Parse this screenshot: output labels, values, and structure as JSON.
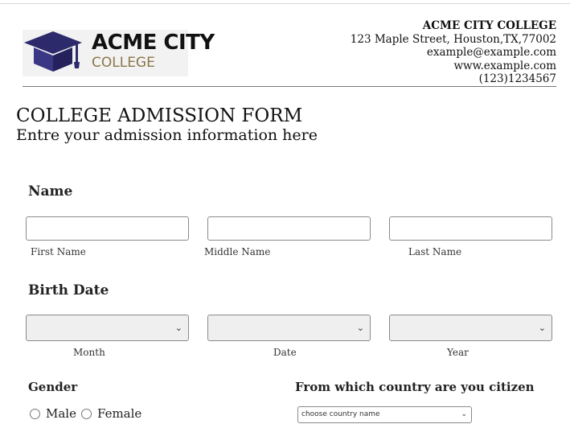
{
  "header": {
    "logo": {
      "name": "ACME CITY",
      "sub": "COLLEGE",
      "icon": "graduation-cap-icon"
    },
    "college_name": "ACME CITY COLLEGE",
    "address": "123 Maple Street, Houston,TX,77002",
    "email": "example@example.com",
    "website": "www.example.com",
    "phone": "(123)1234567"
  },
  "form": {
    "title": "COLLEGE ADMISSION FORM",
    "subtitle": "Entre your admission information here",
    "name_section": {
      "label": "Name",
      "first": "First Name",
      "middle": "Middle Name",
      "last": "Last Name"
    },
    "birth_section": {
      "label": "Birth Date",
      "month": "Month",
      "date": "Date",
      "year": "Year"
    },
    "gender": {
      "label": "Gender",
      "options": [
        "Male",
        "Female"
      ]
    },
    "country": {
      "label": "From which country are you citizen",
      "selected": "choose country name"
    }
  },
  "colors": {
    "brand_navy": "#2c2a6b",
    "brand_gold": "#8a7648"
  }
}
